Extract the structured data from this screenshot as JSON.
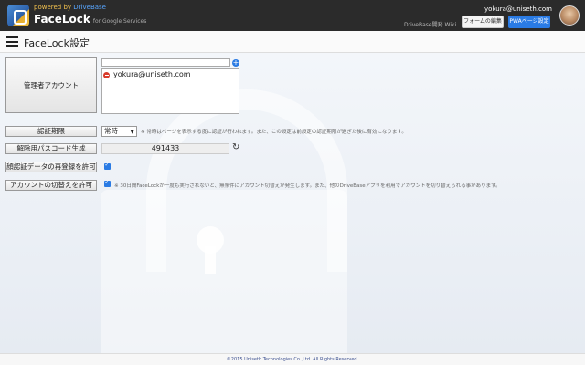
{
  "header": {
    "powered_prefix": "powered by ",
    "powered_brand": "DriveBase",
    "app_title": "FaceLock",
    "app_subtitle": "for Google Services",
    "user_email": "yokura@uniseth.com",
    "wiki_link": "DriveBase開発 Wiki",
    "form_edit_button": "フォームの編集",
    "pwa_settings_button": "PWAページ設定"
  },
  "titlebar": {
    "title": "FaceLock設定"
  },
  "settings": {
    "admin_account_label": "管理者アカウント",
    "admin_input_value": "",
    "admin_accounts": [
      "yokura@uniseth.com"
    ],
    "auth_period_label": "認証期限",
    "auth_period_value": "常時",
    "auth_period_note": "※ 常時はページを表示する度に認証が行われます。また、この設定は前設定の認証期限が過ぎた後に有効になります。",
    "passcode_label": "解除用パスコード生成",
    "passcode_value": "491433",
    "reregister_label": "顔認証データの再登録を許可",
    "switch_account_label": "アカウントの切替えを許可",
    "switch_account_note": "※ 30日間FaceLockが一度も実行されないと、無条件にアカウント切替えが発生します。また、他のDriveBaseアプリを利用でアカウントを切り替えられる事があります。"
  },
  "footer": {
    "copyright": "©2015 Uniseth Technologies Co.,Ltd. All Rights Reserved."
  },
  "colors": {
    "header_bg": "#2b2b2b",
    "accent_blue": "#2a7be4",
    "powered_gold": "#f2c14e",
    "remove_red": "#d83b2b"
  }
}
